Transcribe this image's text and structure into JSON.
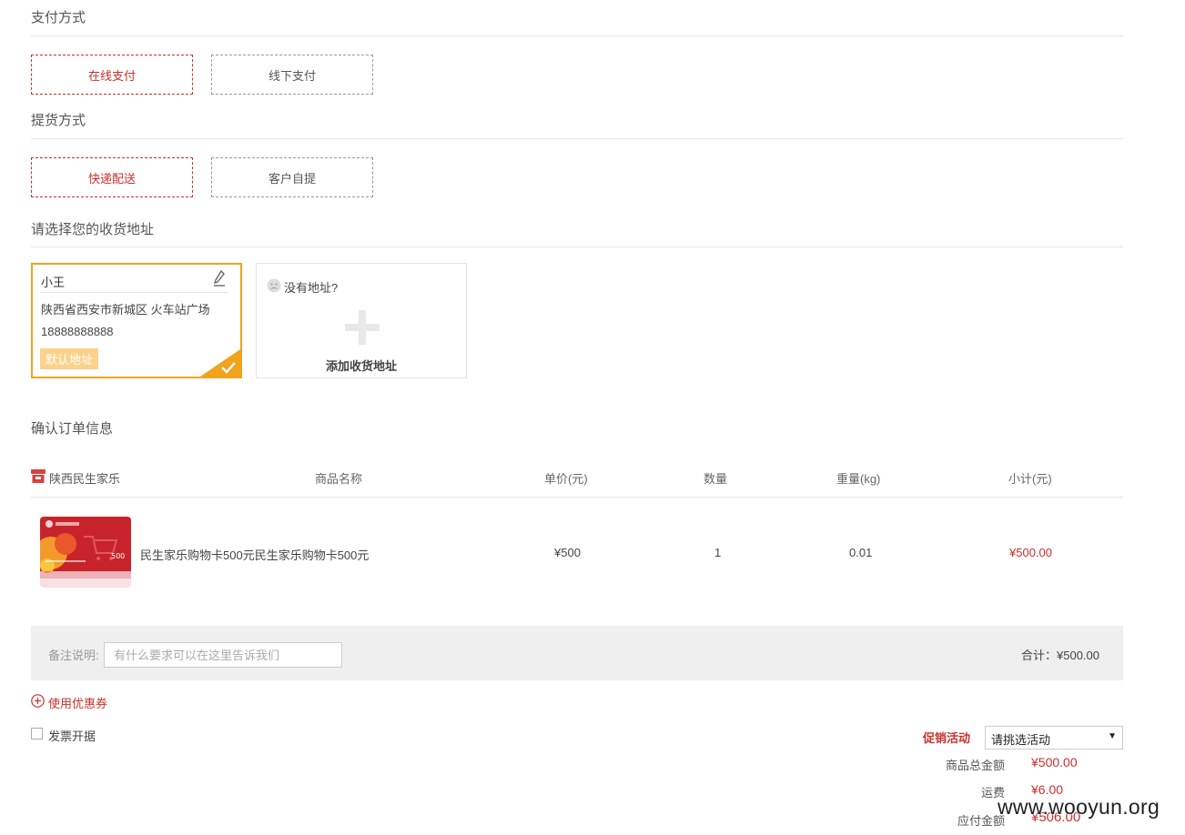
{
  "payment": {
    "title": "支付方式",
    "options": [
      {
        "label": "在线支付",
        "selected": true
      },
      {
        "label": "线下支付",
        "selected": false
      }
    ]
  },
  "delivery": {
    "title": "提货方式",
    "options": [
      {
        "label": "快递配送",
        "selected": true
      },
      {
        "label": "客户自提",
        "selected": false
      }
    ]
  },
  "address": {
    "title": "请选择您的收货地址",
    "selected": {
      "name": "小王",
      "address": "陕西省西安市新城区 火车站广场",
      "phone": "18888888888",
      "tag": "默认地址"
    },
    "add_card": {
      "hint": "没有地址?",
      "label": "添加收货地址"
    }
  },
  "order": {
    "title": "确认订单信息",
    "headers": {
      "shop": "陕西民生家乐",
      "name": "商品名称",
      "price": "单价(元)",
      "qty": "数量",
      "weight": "重量(kg)",
      "subtotal": "小计(元)"
    },
    "items": [
      {
        "name": "民生家乐购物卡500元民生家乐购物卡500元",
        "price": "¥500",
        "qty": "1",
        "weight": "0.01",
        "subtotal": "¥500.00",
        "image_text": "500"
      }
    ]
  },
  "remark": {
    "label": "备注说明:",
    "placeholder": "有什么要求可以在这里告诉我们",
    "total_label": "合计：",
    "total_value": "¥500.00"
  },
  "coupon": {
    "label": "使用优惠券"
  },
  "invoice": {
    "label": "发票开据",
    "checked": false
  },
  "promotion": {
    "label": "促销活动",
    "select_value": "请挑选活动"
  },
  "summary": {
    "goods_total_label": "商品总金额",
    "goods_total_value": "¥500.00",
    "shipping_label": "运费",
    "shipping_value": "¥6.00",
    "payable_label": "应付金额",
    "payable_value": "¥506.00"
  },
  "watermark": "www.wooyun.org",
  "colors": {
    "accent": "#c9302c",
    "address_border": "#f0a31c",
    "default_tag": "#fbd28a"
  }
}
